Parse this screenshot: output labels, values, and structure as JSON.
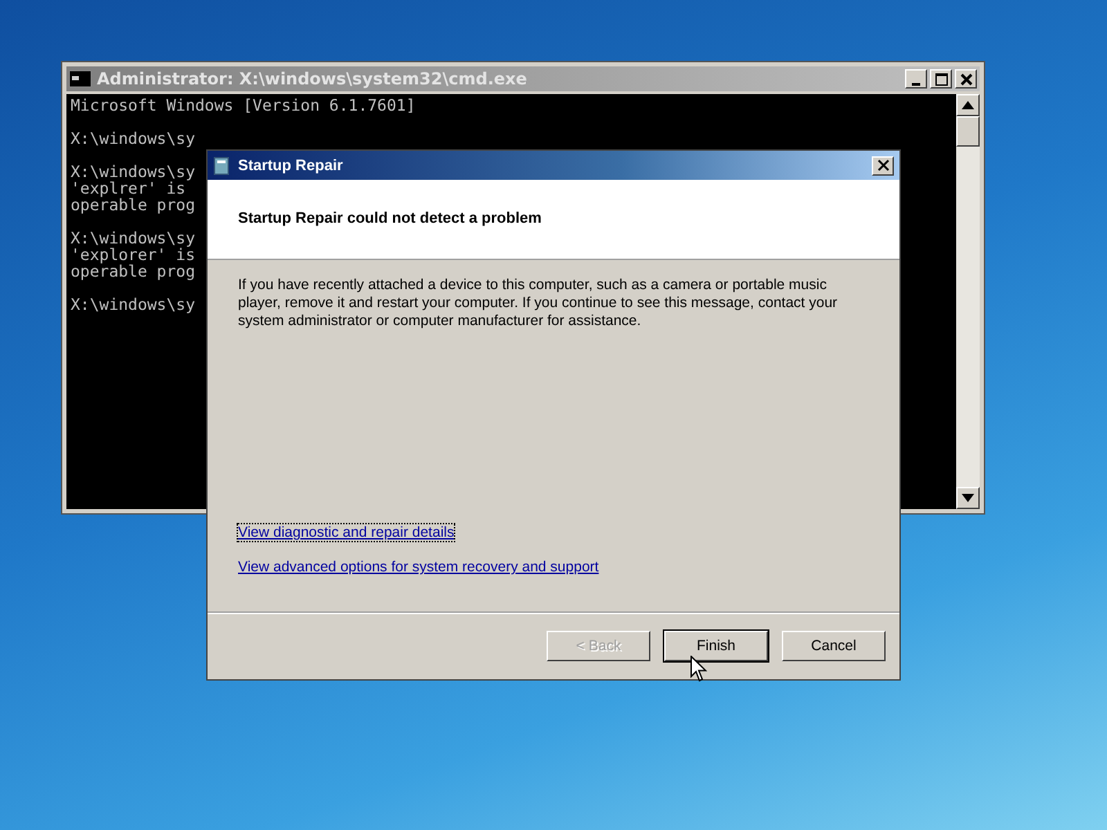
{
  "console_window": {
    "title": "Administrator: X:\\windows\\system32\\cmd.exe",
    "blocks": [
      [
        "Microsoft Windows [Version 6.1.7601]"
      ],
      [
        "X:\\windows\\sy"
      ],
      [
        "X:\\windows\\sy",
        "'explrer' is",
        "operable prog"
      ],
      [
        "X:\\windows\\sy",
        "'explorer' is",
        "operable prog"
      ],
      [
        "X:\\windows\\sy"
      ]
    ]
  },
  "dialog": {
    "title": "Startup Repair",
    "heading": "Startup Repair could not detect a problem",
    "message": "If you have recently attached a device to this computer, such as a camera or portable music player, remove it and restart your computer. If you continue to see this message, contact your system administrator or computer manufacturer for assistance.",
    "links": [
      {
        "label": "View diagnostic and repair details",
        "focused": true
      },
      {
        "label": "View advanced options for system recovery and support",
        "focused": false
      }
    ],
    "buttons": [
      {
        "label": "< Back",
        "disabled": true,
        "default": false
      },
      {
        "label": "Finish",
        "disabled": false,
        "default": true
      },
      {
        "label": "Cancel",
        "disabled": false,
        "default": false
      }
    ]
  }
}
